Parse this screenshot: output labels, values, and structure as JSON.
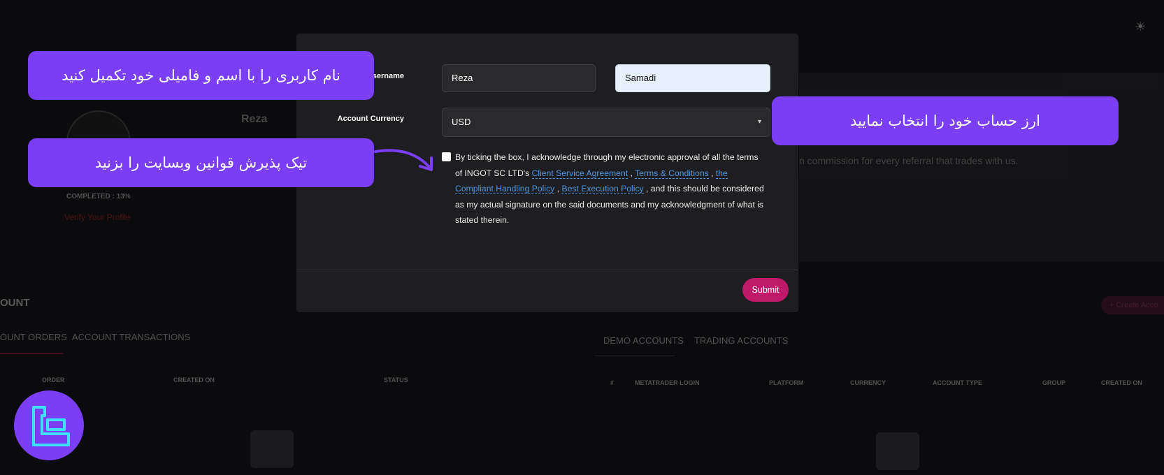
{
  "background": {
    "profile_name": "Reza",
    "completed": "COMPLETED : 13%",
    "verify": "Verify Your Profile",
    "referral_text": "n commission for every referral that trades with us.",
    "section_title": "OUNT",
    "left_tabs": [
      "OUNT ORDERS",
      "ACCOUNT TRANSACTIONS"
    ],
    "left_columns": [
      "ORDER",
      "CREATED ON",
      "STATUS"
    ],
    "right_tabs": [
      "DEMO ACCOUNTS",
      "TRADING ACCOUNTS"
    ],
    "right_columns": [
      "#",
      "METATRADER LOGIN",
      "PLATFORM",
      "CURRENCY",
      "ACCOUNT TYPE",
      "GROUP",
      "CREATED ON"
    ],
    "create_button": "Create Acco",
    "settings_icon": "sun-gear-icon"
  },
  "modal": {
    "username_label": "Username",
    "first_name": "Reza",
    "last_name": "Samadi",
    "currency_label": "Account Currency",
    "currency_value": "USD",
    "terms": {
      "before": "By ticking the box, I acknowledge through my electronic approval of all the terms of INGOT SC LTD's ",
      "link1": "Client Service Agreement",
      "sep1": " , ",
      "link2": "Terms & Conditions",
      "sep2": " , ",
      "link3": "the Compliant Handling Policy",
      "sep3": " , ",
      "link4": "Best Execution Policy",
      "after": " , and this should be considered as my actual signature on the said documents and my acknowledgment of what is stated therein."
    },
    "submit_label": "Submit"
  },
  "callouts": {
    "username": "نام کاربری را با اسم و فامیلی خود تکمیل کنید",
    "currency": "ارز حساب خود را انتخاب نمایید",
    "terms": "تیک پذیرش قوانین وبسایت را بزنید"
  },
  "colors": {
    "accent_purple": "#7a3ff5",
    "submit_pink": "#c0196a",
    "link_blue": "#4f95e0",
    "modal_bg": "#1e1e20"
  }
}
